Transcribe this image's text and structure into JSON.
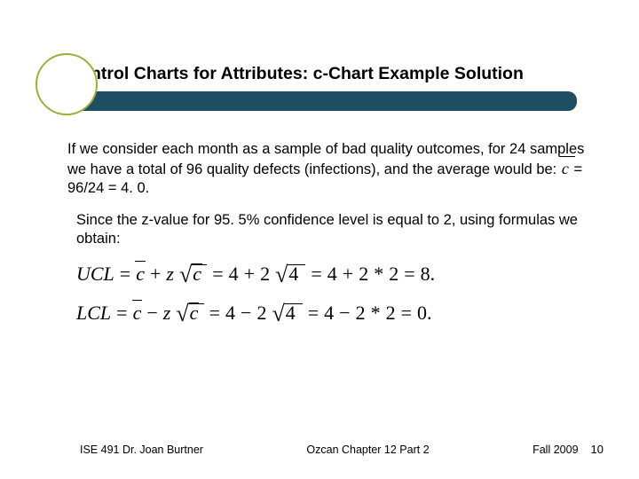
{
  "title": "Control Charts for Attributes: c-Chart Example Solution",
  "body": {
    "para1_before_c": "If we consider each month as a sample of bad quality outcomes, for 24 samples we have a total of 96 quality defects (infections), and the average would be:    ",
    "para1_after_c": "  = 96/24 = 4. 0.",
    "para2": "Since the z-value for 95. 5% confidence level is equal to 2, using formulas we obtain:"
  },
  "formula": {
    "ucl_label": "UCL",
    "lcl_label": "LCL",
    "c": "c",
    "z": "z",
    "eq": "=",
    "plus": "+",
    "minus": "−",
    "mult": "*",
    "four": "4",
    "two": "2",
    "eight": "8.",
    "zero": "0."
  },
  "footer": {
    "left": "ISE 491  Dr. Joan Burtner",
    "center": "Ozcan Chapter 12 Part 2",
    "right": "Fall 2009",
    "page": "10"
  }
}
